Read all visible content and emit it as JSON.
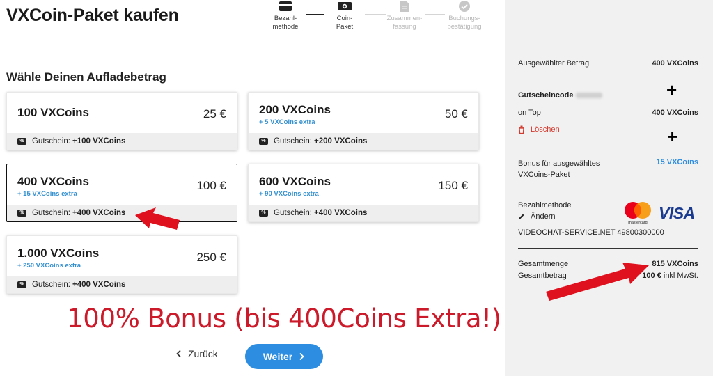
{
  "page": {
    "title": "VXCoin-Paket kaufen"
  },
  "stepper": {
    "steps": [
      {
        "line1": "Bezahl-",
        "line2": "methode",
        "icon": "card-icon",
        "active": true
      },
      {
        "line1": "Coin-",
        "line2": "Paket",
        "icon": "banknote-icon",
        "active": true
      },
      {
        "line1": "Zusammen-",
        "line2": "fassung",
        "icon": "document-icon",
        "active": false
      },
      {
        "line1": "Buchungs-",
        "line2": "bestätigung",
        "icon": "check-circle-icon",
        "active": false
      }
    ]
  },
  "section": {
    "title": "Wähle Deinen Aufladebetrag"
  },
  "packages": [
    {
      "amount": "100 VXCoins",
      "extra": "",
      "price": "25 €",
      "voucher_label": "Gutschein:",
      "voucher_value": "+100 VXCoins",
      "selected": false
    },
    {
      "amount": "200 VXCoins",
      "extra": "+ 5 VXCoins extra",
      "price": "50 €",
      "voucher_label": "Gutschein:",
      "voucher_value": "+200 VXCoins",
      "selected": false
    },
    {
      "amount": "400 VXCoins",
      "extra": "+ 15 VXCoins extra",
      "price": "100 €",
      "voucher_label": "Gutschein:",
      "voucher_value": "+400 VXCoins",
      "selected": true
    },
    {
      "amount": "600 VXCoins",
      "extra": "+ 90 VXCoins extra",
      "price": "150 €",
      "voucher_label": "Gutschein:",
      "voucher_value": "+400 VXCoins",
      "selected": false
    },
    {
      "amount": "1.000 VXCoins",
      "extra": "+ 250 VXCoins extra",
      "price": "250 €",
      "voucher_label": "Gutschein:",
      "voucher_value": "+400 VXCoins",
      "selected": false
    }
  ],
  "voucher_tag": "%",
  "promo": {
    "text": "100% Bonus (bis 400Coins Extra!)",
    "color": "#cc1a2a"
  },
  "nav": {
    "back_label": "Zurück",
    "next_label": "Weiter"
  },
  "summary": {
    "selected_label": "Ausgewählter Betrag",
    "selected_value": "400 VXCoins",
    "voucher_code_label": "Gutscheincode",
    "on_top_label": "on Top",
    "on_top_value": "400 VXCoins",
    "delete_label": "Löschen",
    "bonus_label_1": "Bonus für ausgewähltes",
    "bonus_label_2": "VXCoins-Paket",
    "bonus_value": "15 VXCoins",
    "payment_label": "Bezahlmethode",
    "edit_label": "Ändern",
    "merchant": "VIDEOCHAT-SERVICE.NET 49800300000",
    "total_amount_label": "Gesamtmenge",
    "total_amount_value": "815 VXCoins",
    "total_price_label": "Gesamtbetrag",
    "total_price_value": "100 €",
    "total_price_suffix": "inkl MwSt.",
    "mastercard_text": "mastercard",
    "visa_text": "VISA"
  },
  "colors": {
    "accent": "#2d8de0",
    "extra_blue": "#3490d0",
    "delete_red": "#d23b2f",
    "arrow_red": "#e0111f"
  }
}
